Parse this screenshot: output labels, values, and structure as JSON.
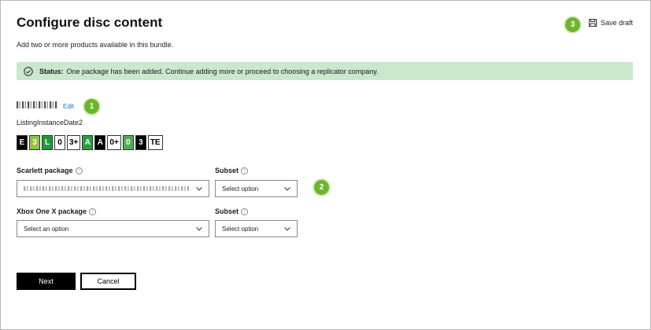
{
  "header": {
    "title": "Configure disc content",
    "subtitle": "Add two or more products available in this bundle.",
    "save_draft_label": "Save draft"
  },
  "status": {
    "label": "Status:",
    "message": "One package has been added. Continue adding more or proceed to choosing a replicator company."
  },
  "listing": {
    "edit_label": "Edit",
    "instance_date": "ListingInstanceDate2"
  },
  "ratings": [
    {
      "icon": "esrb-e-rating-icon",
      "text": "E",
      "bg": "#000000",
      "fg": "#ffffff"
    },
    {
      "icon": "pegi-3-rating-icon",
      "text": "3",
      "bg": "#8cc63f",
      "fg": "#ffffff"
    },
    {
      "icon": "classind-l-rating-icon",
      "text": "L",
      "bg": "#1e9b3b",
      "fg": "#ffffff"
    },
    {
      "icon": "rating-0-diamond-icon",
      "text": "0",
      "bg": "#ffffff",
      "fg": "#000000"
    },
    {
      "icon": "usk-3-rating-icon",
      "text": "3+",
      "bg": "#ffffff",
      "fg": "#000000"
    },
    {
      "icon": "rating-all-green-icon",
      "text": "A",
      "bg": "#2a9d3c",
      "fg": "#ffffff"
    },
    {
      "icon": "rating-a-green-icon",
      "text": "A",
      "bg": "#000000",
      "fg": "#ffffff"
    },
    {
      "icon": "rating-0-white-icon",
      "text": "0+",
      "bg": "#ffffff",
      "fg": "#000000"
    },
    {
      "icon": "rating-0-green-circle-icon",
      "text": "0",
      "bg": "#4caf50",
      "fg": "#ffffff"
    },
    {
      "icon": "rating-3-black-icon",
      "text": "3",
      "bg": "#000000",
      "fg": "#ffffff"
    },
    {
      "icon": "rating-te-icon",
      "text": "TE",
      "bg": "#ffffff",
      "fg": "#000000"
    }
  ],
  "form": {
    "scarlett_label": "Scarlett package",
    "scarlett_subset_label": "Subset",
    "scarlett_subset_value": "Select option",
    "xbox_label": "Xbox One X package",
    "xbox_value": "Select an option",
    "xbox_subset_label": "Subset",
    "xbox_subset_value": "Select option"
  },
  "actions": {
    "next_label": "Next",
    "cancel_label": "Cancel"
  },
  "callouts": {
    "one": "1",
    "two": "2",
    "three": "3"
  },
  "colors": {
    "callout": "#6cb52d",
    "status_bg": "#c9e8cc",
    "link": "#1a6fc2"
  }
}
